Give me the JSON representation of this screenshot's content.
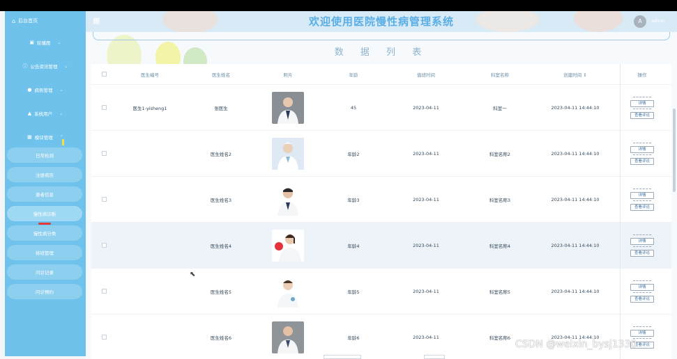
{
  "header": {
    "title": "欢迎使用医院慢性病管理系统",
    "user": "admin"
  },
  "sidebar": {
    "home": "后台首页",
    "menus": [
      {
        "label": "轮播图",
        "icon": "picture-icon"
      },
      {
        "label": "公告资讯管理",
        "icon": "info-icon"
      },
      {
        "label": "病例管理",
        "icon": "pin-icon"
      },
      {
        "label": "系统用户",
        "icon": "user-icon"
      },
      {
        "label": "模块管理",
        "icon": "grid-icon"
      }
    ],
    "subs": [
      "日常检测",
      "注册病历",
      "患者信息",
      "慢性病诊断",
      "慢性病分类",
      "排班管理",
      "问诊记录",
      "问诊预约"
    ]
  },
  "page": {
    "heading": "数 据 列 表"
  },
  "table": {
    "headers": [
      "医生编号",
      "医生姓名",
      "照片",
      "年龄",
      "值班时间",
      "科室名称",
      "创建时间 ⇕",
      "操作"
    ],
    "actions": {
      "detail": "详情",
      "review": "查看评论"
    },
    "rows": [
      {
        "id": "医生1-yisheng1",
        "name": "张医生",
        "age": "45",
        "date": "2023-04-11",
        "dept": "科室一",
        "created": "2023-04-11 14:44:10"
      },
      {
        "id": "",
        "name": "医生姓名2",
        "age": "年龄2",
        "date": "2023-04-11",
        "dept": "科室名称2",
        "created": "2023-04-11 14:44:10"
      },
      {
        "id": "",
        "name": "医生姓名3",
        "age": "年龄3",
        "date": "2023-04-11",
        "dept": "科室名称3",
        "created": "2023-04-11 14:44:10"
      },
      {
        "id": "",
        "name": "医生姓名4",
        "age": "年龄4",
        "date": "2023-04-11",
        "dept": "科室名称4",
        "created": "2023-04-11 14:44:10"
      },
      {
        "id": "",
        "name": "医生姓名5",
        "age": "年龄5",
        "date": "2023-04-11",
        "dept": "科室名称5",
        "created": "2023-04-11 14:44:10"
      },
      {
        "id": "",
        "name": "医生姓名6",
        "age": "年龄6",
        "date": "2023-04-11",
        "dept": "科室名称6",
        "created": "2023-04-11 14:44:10"
      }
    ]
  },
  "watermark": "CSDN @weixin_bysj1330"
}
